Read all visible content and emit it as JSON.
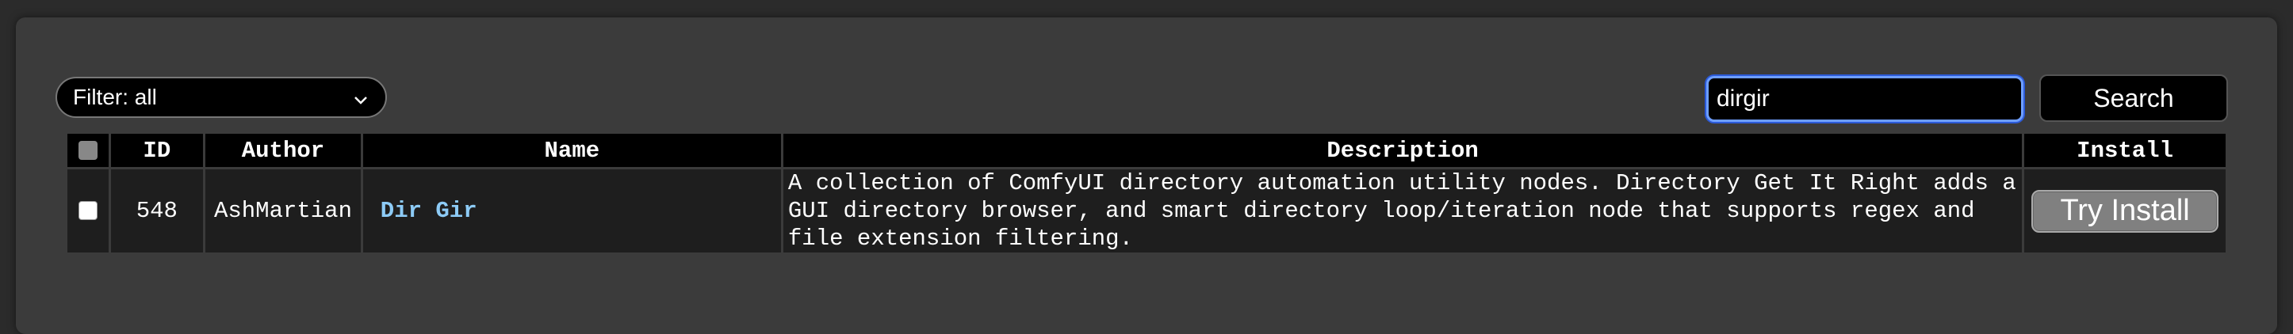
{
  "filter": {
    "selected": "Filter: all",
    "chevron_icon": "chevron-down-icon"
  },
  "search": {
    "value": "dirgir",
    "button_label": "Search"
  },
  "table": {
    "headers": {
      "id": "ID",
      "author": "Author",
      "name": "Name",
      "description": "Description",
      "install": "Install"
    },
    "rows": [
      {
        "id": "548",
        "author": "AshMartian",
        "name": "Dir Gir",
        "description": "A collection of ComfyUI directory automation utility nodes. Directory Get It Right adds a GUI directory browser, and smart directory loop/iteration node that supports regex and file extension filtering.",
        "install_label": "Try Install"
      }
    ]
  },
  "colors": {
    "background": "#2b2b2b",
    "panel": "#3b3b3b",
    "link": "#8dcbf6",
    "focus_ring": "#6f9fff",
    "install_button": "#808080"
  }
}
